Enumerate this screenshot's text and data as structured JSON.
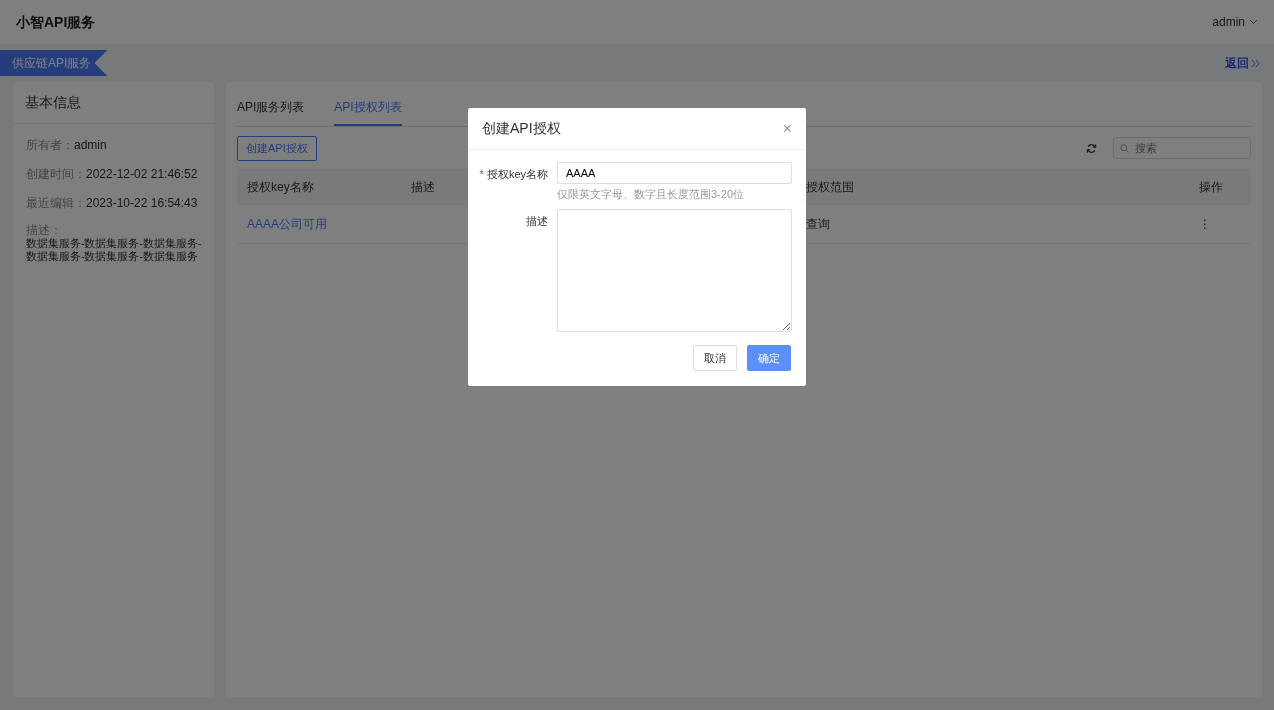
{
  "header": {
    "app_title": "小智API服务",
    "user": "admin"
  },
  "service_tag": "供应链API服务",
  "back_link": "返回",
  "info_card": {
    "title": "基本信息",
    "fields": [
      {
        "label": "所有者：",
        "value": "admin"
      },
      {
        "label": "创建时间：",
        "value": "2022-12-02 21:46:52"
      },
      {
        "label": "最近编辑：",
        "value": "2023-10-22 16:54:43"
      }
    ],
    "description_label": "描述：",
    "description": "数据集服务-数据集服务-数据集服务-数据集服务-数据集服务-数据集服务"
  },
  "tabs": [
    {
      "label": "API服务列表",
      "selected": false
    },
    {
      "label": "API授权列表",
      "selected": true
    }
  ],
  "create_button": "创建API授权",
  "search": {
    "placeholder": "搜索"
  },
  "table": {
    "columns": [
      "授权key名称",
      "描述",
      "授权范围",
      "操作"
    ],
    "rows": [
      [
        "AAAA公司可用",
        "",
        "查询",
        "⋮"
      ]
    ]
  },
  "dialog": {
    "title": "创建API授权",
    "close": "×",
    "fields": [
      {
        "kind": "input",
        "required_mark": "*",
        "label": "授权key名称",
        "value": "AAAA",
        "help": "仅限英文字母、数字且长度范围3-20位"
      },
      {
        "kind": "textarea",
        "label": "描述"
      }
    ],
    "buttons": [
      {
        "label": "取消",
        "primary": false
      },
      {
        "label": "确定",
        "primary": true
      }
    ]
  }
}
